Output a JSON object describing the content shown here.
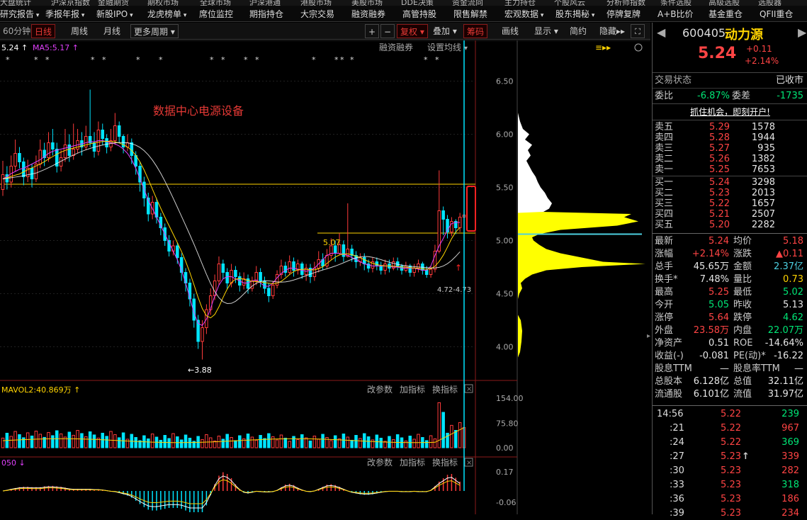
{
  "top_strip": [
    "大盘统计",
    "沪深京指数",
    "金融期货",
    "期权市场",
    "全球市场",
    "沪深港通",
    "港股市场",
    "美股市场",
    "DDE决策",
    "资金流向",
    "主力持仓",
    "个股风云",
    "分析师指数",
    "条件选股",
    "高级选股",
    "选股器"
  ],
  "menu": [
    "研究报告",
    "季报年报",
    "新股IPO",
    "龙虎榜单",
    "席位监控",
    "期指持仓",
    "大宗交易",
    "融资融券",
    "高管持股",
    "限售解禁",
    "宏观数据",
    "股东揭秘",
    "停牌复牌",
    "A+B比价",
    "基金重仓",
    "QFII重仓"
  ],
  "menu_arrows": [
    true,
    true,
    true,
    true,
    false,
    false,
    false,
    false,
    false,
    false,
    true,
    true,
    false,
    false,
    false,
    false
  ],
  "toolbar": {
    "period_dropdown": "60分钟",
    "day": "日线",
    "week": "周线",
    "month": "月线",
    "more": "更多周期",
    "plus": "+",
    "minus": "−",
    "fuquan": "复权",
    "overlay": "叠加",
    "chips": "筹码",
    "draw": "画线",
    "display": "显示",
    "simple": "简约",
    "hide": "隐藏▸▸",
    "fullscreen_icon": "fullscreen-icon"
  },
  "chart": {
    "ma_legend_a": "5.24 ↑",
    "ma_legend_b": "MA5:5.17 ↑",
    "rzrq": "融资融券",
    "set_ma": "设置均线",
    "annotation": "数据中心电源设备",
    "label_high": "5.07",
    "label_low": "3.88",
    "label_range": "4.72-4.73",
    "price_ticks": [
      "6.50",
      "6.00",
      "5.50",
      "5.00",
      "4.50",
      "4.00"
    ],
    "vol_legend": "MAVOL2:40.869万 ↑",
    "vol_ticks": [
      "154.00",
      "75.80",
      "0.00"
    ],
    "macd_legend": "050 ↓",
    "macd_ticks": [
      "0.17",
      "-0.06"
    ],
    "tools": [
      "改参数",
      "加指标",
      "换指标"
    ]
  },
  "colors": {
    "up": "#ff3b3b",
    "down": "#00e5ff",
    "ma5": "#ffffff",
    "ma10": "#ffd400",
    "ma20": "#e040fb",
    "accent": "#ff4444",
    "profile": "#ffff00"
  },
  "chart_data": {
    "type": "candlestick",
    "price_ylim": [
      3.75,
      6.75
    ],
    "hline": 5.53,
    "candles": [
      [
        5.48,
        5.62,
        5.75,
        5.42
      ],
      [
        5.62,
        5.55,
        5.7,
        5.48
      ],
      [
        5.55,
        5.7,
        5.8,
        5.5
      ],
      [
        5.7,
        5.82,
        5.95,
        5.65
      ],
      [
        5.82,
        5.74,
        5.88,
        5.68
      ],
      [
        5.74,
        5.6,
        5.78,
        5.52
      ],
      [
        5.6,
        5.68,
        5.76,
        5.55
      ],
      [
        5.68,
        5.58,
        5.72,
        5.5
      ],
      [
        5.58,
        5.72,
        5.8,
        5.55
      ],
      [
        5.72,
        5.85,
        5.95,
        5.68
      ],
      [
        5.85,
        5.78,
        5.92,
        5.7
      ],
      [
        5.78,
        5.92,
        6.02,
        5.74
      ],
      [
        5.92,
        5.86,
        6.05,
        5.8
      ],
      [
        5.86,
        5.7,
        5.92,
        5.64
      ],
      [
        5.7,
        5.78,
        5.85,
        5.65
      ],
      [
        5.78,
        5.9,
        6.05,
        5.74
      ],
      [
        5.9,
        5.8,
        6.0,
        5.74
      ],
      [
        5.8,
        5.86,
        6.1,
        5.76
      ],
      [
        5.86,
        5.94,
        6.05,
        5.82
      ],
      [
        5.94,
        5.88,
        6.02,
        5.8
      ],
      [
        5.88,
        5.98,
        6.08,
        5.85
      ],
      [
        5.98,
        5.92,
        6.42,
        5.88
      ],
      [
        5.92,
        5.84,
        6.02,
        5.78
      ],
      [
        5.84,
        6.04,
        6.12,
        5.8
      ],
      [
        6.04,
        5.96,
        6.1,
        5.9
      ],
      [
        5.96,
        5.88,
        6.0,
        5.82
      ],
      [
        5.88,
        5.94,
        6.05,
        5.84
      ],
      [
        5.94,
        6.08,
        6.2,
        5.9
      ],
      [
        6.08,
        5.98,
        6.12,
        5.92
      ],
      [
        5.98,
        5.88,
        6.0,
        5.82
      ],
      [
        5.88,
        5.92,
        6.0,
        5.84
      ],
      [
        5.92,
        5.8,
        5.96,
        5.72
      ],
      [
        5.8,
        5.7,
        5.84,
        5.62
      ],
      [
        5.7,
        5.55,
        5.74,
        5.46
      ],
      [
        5.55,
        5.4,
        5.6,
        5.32
      ],
      [
        5.4,
        5.25,
        5.45,
        5.18
      ],
      [
        5.25,
        5.36,
        5.42,
        5.2
      ],
      [
        5.36,
        5.22,
        5.4,
        5.16
      ],
      [
        5.22,
        5.12,
        5.26,
        5.05
      ],
      [
        5.12,
        5.0,
        5.16,
        4.95
      ],
      [
        5.0,
        4.9,
        5.05,
        4.85
      ],
      [
        4.9,
        4.95,
        5.0,
        4.86
      ],
      [
        4.95,
        4.84,
        4.98,
        4.78
      ],
      [
        4.84,
        4.7,
        4.88,
        4.62
      ],
      [
        4.7,
        4.6,
        4.74,
        4.52
      ],
      [
        4.6,
        4.45,
        4.64,
        4.38
      ],
      [
        4.45,
        4.25,
        4.5,
        4.18
      ],
      [
        4.25,
        4.05,
        4.3,
        3.98
      ],
      [
        4.05,
        4.18,
        4.25,
        3.88
      ],
      [
        4.18,
        4.35,
        4.4,
        4.12
      ],
      [
        4.35,
        4.48,
        4.55,
        4.3
      ],
      [
        4.48,
        4.62,
        4.68,
        4.44
      ],
      [
        4.62,
        4.78,
        4.85,
        4.58
      ],
      [
        4.78,
        4.7,
        4.82,
        4.64
      ],
      [
        4.7,
        4.6,
        4.74,
        4.54
      ],
      [
        4.6,
        4.72,
        4.78,
        4.56
      ],
      [
        4.72,
        4.66,
        4.76,
        4.6
      ],
      [
        4.66,
        4.58,
        4.7,
        4.52
      ],
      [
        4.58,
        4.64,
        4.7,
        4.54
      ],
      [
        4.64,
        4.55,
        4.68,
        4.5
      ],
      [
        4.55,
        4.62,
        4.66,
        4.52
      ],
      [
        4.62,
        4.7,
        4.76,
        4.58
      ],
      [
        4.7,
        4.62,
        4.74,
        4.56
      ],
      [
        4.62,
        4.55,
        4.66,
        4.5
      ],
      [
        4.55,
        4.48,
        4.6,
        4.42
      ],
      [
        4.48,
        4.58,
        4.62,
        4.45
      ],
      [
        4.58,
        4.68,
        4.72,
        4.55
      ],
      [
        4.68,
        4.76,
        4.82,
        4.64
      ],
      [
        4.76,
        4.7,
        4.8,
        4.66
      ],
      [
        4.7,
        4.8,
        4.86,
        4.68
      ],
      [
        4.8,
        4.72,
        4.84,
        4.66
      ],
      [
        4.72,
        4.78,
        4.82,
        4.68
      ],
      [
        4.78,
        4.68,
        4.8,
        4.64
      ],
      [
        4.68,
        4.74,
        4.78,
        4.62
      ],
      [
        4.74,
        4.66,
        4.78,
        4.6
      ],
      [
        4.66,
        4.74,
        4.8,
        4.62
      ],
      [
        4.74,
        4.82,
        4.9,
        4.7
      ],
      [
        4.82,
        4.76,
        4.88,
        4.72
      ],
      [
        4.76,
        4.86,
        4.92,
        4.74
      ],
      [
        4.86,
        4.95,
        5.02,
        4.82
      ],
      [
        4.95,
        4.88,
        5.0,
        4.8
      ],
      [
        4.88,
        4.96,
        5.07,
        4.86
      ],
      [
        4.96,
        4.85,
        5.0,
        4.8
      ],
      [
        4.85,
        4.92,
        5.35,
        4.84
      ],
      [
        4.92,
        4.86,
        4.96,
        4.8
      ],
      [
        4.86,
        4.8,
        4.9,
        4.74
      ],
      [
        4.8,
        4.84,
        4.88,
        4.76
      ],
      [
        4.84,
        4.78,
        4.88,
        4.72
      ],
      [
        4.78,
        4.74,
        4.82,
        4.7
      ],
      [
        4.74,
        4.8,
        4.84,
        4.7
      ],
      [
        4.8,
        4.76,
        4.84,
        4.72
      ],
      [
        4.76,
        4.72,
        4.8,
        4.68
      ],
      [
        4.72,
        4.78,
        4.82,
        4.68
      ],
      [
        4.78,
        4.74,
        4.82,
        4.7
      ],
      [
        4.74,
        4.8,
        4.84,
        4.72
      ],
      [
        4.8,
        4.76,
        4.84,
        4.72
      ],
      [
        4.76,
        4.72,
        4.78,
        4.68
      ],
      [
        4.72,
        4.76,
        4.8,
        4.7
      ],
      [
        4.76,
        4.7,
        4.78,
        4.66
      ],
      [
        4.7,
        4.74,
        4.78,
        4.66
      ],
      [
        4.74,
        4.78,
        4.82,
        4.7
      ],
      [
        4.78,
        4.72,
        4.8,
        4.68
      ],
      [
        4.72,
        4.68,
        4.76,
        4.65
      ],
      [
        4.68,
        4.73,
        4.76,
        4.65
      ],
      [
        4.73,
        4.9,
        4.96,
        4.7
      ],
      [
        4.9,
        5.28,
        5.66,
        4.88
      ],
      [
        5.28,
        5.2,
        5.32,
        5.05
      ],
      [
        5.2,
        5.08,
        5.24,
        5.02
      ],
      [
        5.08,
        5.18,
        5.22,
        5.04
      ],
      [
        5.18,
        5.12,
        5.2,
        5.06
      ],
      [
        5.12,
        5.22,
        5.26,
        5.08
      ],
      [
        5.22,
        5.24,
        5.25,
        5.02
      ]
    ],
    "ma5": [
      5.58,
      5.6,
      5.63,
      5.65,
      5.67,
      5.68,
      5.7,
      5.72,
      5.74,
      5.76,
      5.79,
      5.82,
      5.84,
      5.85,
      5.86,
      5.87,
      5.88,
      5.89,
      5.9,
      5.91,
      5.92,
      5.93,
      5.93,
      5.94,
      5.94,
      5.93,
      5.92,
      5.91,
      5.89,
      5.86,
      5.82,
      5.76,
      5.68,
      5.58,
      5.48,
      5.38,
      5.3,
      5.22,
      5.14,
      5.06,
      4.98,
      4.9,
      4.82,
      4.72,
      4.6,
      4.46,
      4.32,
      4.22,
      4.2,
      4.26,
      4.36,
      4.48,
      4.58,
      4.64,
      4.66,
      4.66,
      4.64,
      4.62,
      4.6,
      4.6,
      4.62,
      4.63,
      4.6,
      4.57,
      4.57,
      4.6,
      4.65,
      4.69,
      4.72,
      4.74,
      4.74,
      4.73,
      4.72,
      4.71,
      4.72,
      4.74,
      4.78,
      4.82,
      4.86,
      4.88,
      4.88,
      4.88,
      4.87,
      4.86,
      4.84,
      4.82,
      4.8,
      4.78,
      4.77,
      4.76,
      4.76,
      4.76,
      4.76,
      4.76,
      4.75,
      4.75,
      4.74,
      4.74,
      4.74,
      4.74,
      4.73,
      4.72,
      4.72,
      4.76,
      4.86,
      4.95,
      5.02,
      5.1,
      5.16,
      5.17,
      5.17
    ]
  },
  "quote": {
    "code": "600405",
    "name": "动力源",
    "price": "5.24",
    "change": "+0.11",
    "pct": "+2.14%"
  },
  "status": {
    "label": "交易状态",
    "value": "已收市"
  },
  "weibi": {
    "label": "委比",
    "value": "-6.87%",
    "label2": "委差",
    "value2": "-1735"
  },
  "promo": "抓住机会，即刻开户!",
  "sells": [
    {
      "l": "卖五",
      "p": "5.29",
      "v": "1578"
    },
    {
      "l": "卖四",
      "p": "5.28",
      "v": "1944"
    },
    {
      "l": "卖三",
      "p": "5.27",
      "v": "935"
    },
    {
      "l": "卖二",
      "p": "5.26",
      "v": "1382"
    },
    {
      "l": "卖一",
      "p": "5.25",
      "v": "7653"
    }
  ],
  "buys": [
    {
      "l": "买一",
      "p": "5.24",
      "v": "3298"
    },
    {
      "l": "买二",
      "p": "5.23",
      "v": "2013"
    },
    {
      "l": "买三",
      "p": "5.22",
      "v": "1657"
    },
    {
      "l": "买四",
      "p": "5.21",
      "v": "2507"
    },
    {
      "l": "买五",
      "p": "5.20",
      "v": "2282"
    }
  ],
  "stats": [
    {
      "l": "最新",
      "v": "5.24",
      "c": "red",
      "l2": "均价",
      "v2": "5.18",
      "c2": "red"
    },
    {
      "l": "涨幅",
      "v": "+2.14%",
      "c": "red",
      "l2": "涨跌",
      "v2": "▲0.11",
      "c2": "red"
    },
    {
      "l": "总手",
      "v": "45.65万",
      "c": "white",
      "l2": "金额",
      "v2": "2.37亿",
      "c2": "cyan"
    },
    {
      "l": "换手*",
      "v": "7.48%",
      "c": "white",
      "l2": "量比",
      "v2": "0.73",
      "c2": "yellow"
    },
    {
      "l": "最高",
      "v": "5.25",
      "c": "red",
      "l2": "最低",
      "v2": "5.02",
      "c2": "green"
    },
    {
      "l": "今开",
      "v": "5.05",
      "c": "green",
      "l2": "昨收",
      "v2": "5.13",
      "c2": "white"
    },
    {
      "l": "涨停",
      "v": "5.64",
      "c": "red",
      "l2": "跌停",
      "v2": "4.62",
      "c2": "green"
    },
    {
      "l": "外盘",
      "v": "23.58万",
      "c": "red",
      "l2": "内盘",
      "v2": "22.07万",
      "c2": "green"
    },
    {
      "l": "净资产",
      "v": "0.51",
      "c": "white",
      "l2": "ROE",
      "v2": "-14.64%",
      "c2": "white"
    },
    {
      "l": "收益(-)",
      "v": "-0.081",
      "c": "white",
      "l2": "PE(动)*",
      "v2": "-16.22",
      "c2": "white"
    },
    {
      "l": "股息TTM",
      "v": "—",
      "c": "white",
      "l2": "股息率TTM",
      "v2": "—",
      "c2": "white"
    },
    {
      "l": "总股本",
      "v": "6.128亿",
      "c": "white",
      "l2": "总值",
      "v2": "32.11亿",
      "c2": "white"
    },
    {
      "l": "流通股",
      "v": "6.101亿",
      "c": "white",
      "l2": "流值",
      "v2": "31.97亿",
      "c2": "white"
    }
  ],
  "ticks": [
    {
      "t": "14:56",
      "p": "5.22",
      "v": "239",
      "c": "green",
      "arrow": ""
    },
    {
      "t": ":21",
      "p": "5.22",
      "v": "967",
      "c": "red",
      "arrow": ""
    },
    {
      "t": ":24",
      "p": "5.22",
      "v": "369",
      "c": "green",
      "arrow": ""
    },
    {
      "t": ":27",
      "p": "5.23",
      "v": "339",
      "c": "red",
      "arrow": "↑"
    },
    {
      "t": ":30",
      "p": "5.23",
      "v": "282",
      "c": "red",
      "arrow": ""
    },
    {
      "t": ":33",
      "p": "5.23",
      "v": "318",
      "c": "green",
      "arrow": ""
    },
    {
      "t": ":36",
      "p": "5.23",
      "v": "186",
      "c": "red",
      "arrow": ""
    },
    {
      "t": ":39",
      "p": "5.23",
      "v": "234",
      "c": "red",
      "arrow": ""
    }
  ]
}
